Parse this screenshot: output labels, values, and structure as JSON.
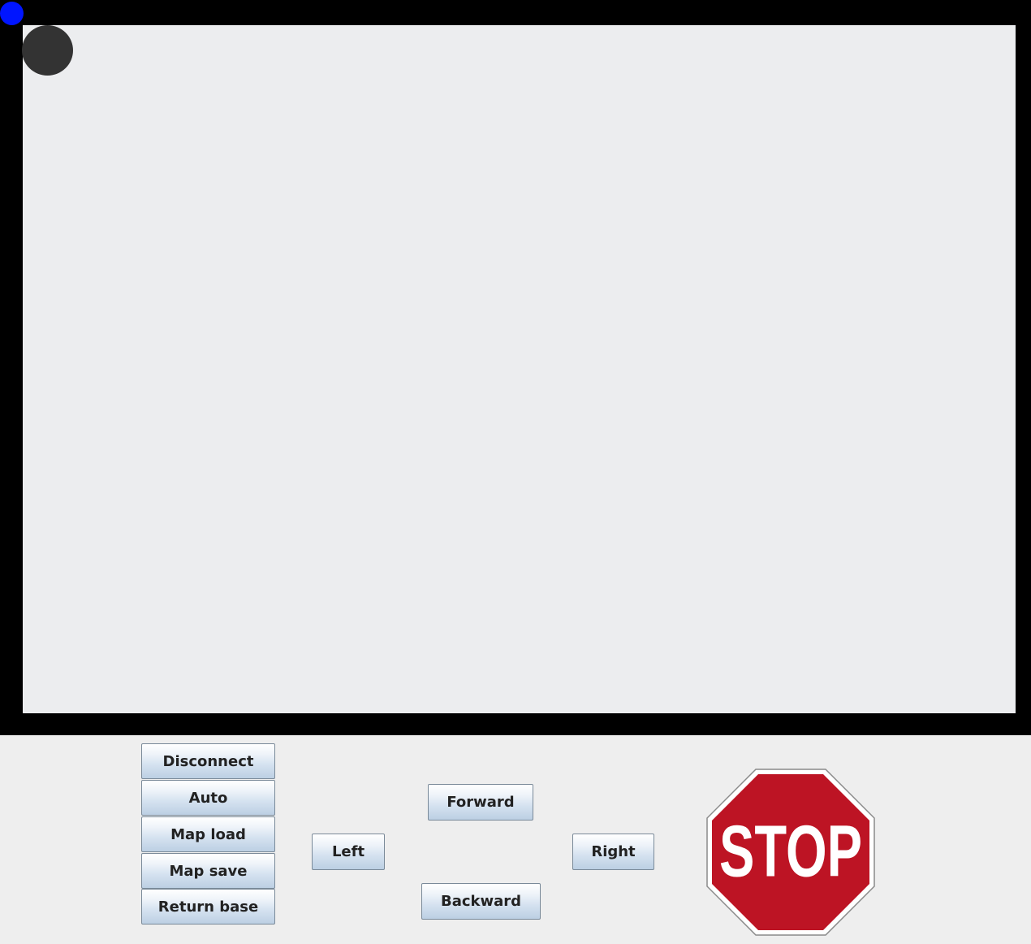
{
  "colors": {
    "robot": "#333333",
    "base_marker": "#0015ff",
    "frame": "#000000",
    "canvas": "#ecedef",
    "stop_red": "#bd1424"
  },
  "controls": {
    "disconnect_label": "Disconnect",
    "auto_label": "Auto",
    "map_load_label": "Map load",
    "map_save_label": "Map save",
    "return_base_label": "Return base",
    "left_label": "Left",
    "forward_label": "Forward",
    "backward_label": "Backward",
    "right_label": "Right",
    "stop_label": "STOP"
  }
}
